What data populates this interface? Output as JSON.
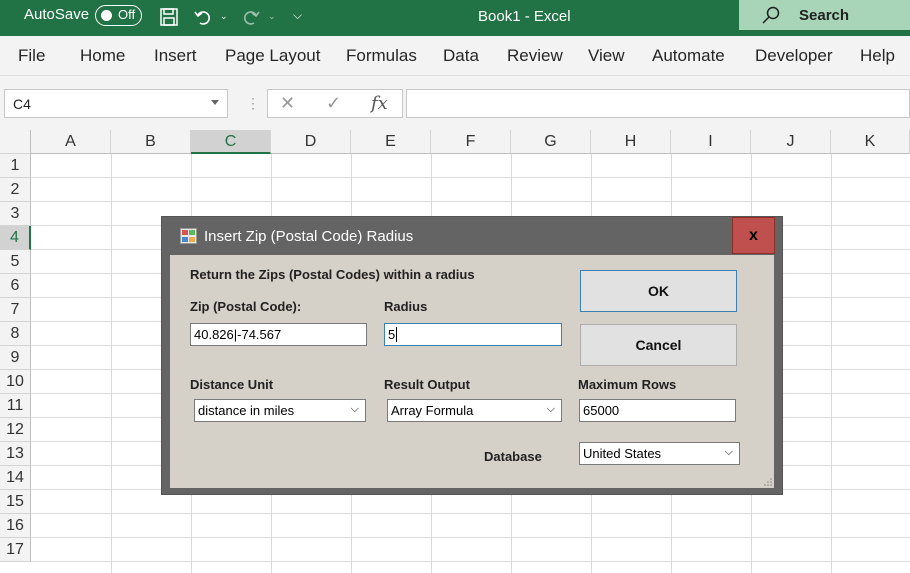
{
  "titlebar": {
    "autosave_label": "AutoSave",
    "autosave_state": "Off",
    "document_title": "Book1  -  Excel",
    "search_label": "Search",
    "icons": [
      "save-icon",
      "undo-icon",
      "redo-icon",
      "customize-qat-icon",
      "search-icon"
    ]
  },
  "ribbon": {
    "tabs": [
      "File",
      "Home",
      "Insert",
      "Page Layout",
      "Formulas",
      "Data",
      "Review",
      "View",
      "Automate",
      "Developer",
      "Help"
    ]
  },
  "formula_bar": {
    "name_box": "C4",
    "fx_label": "fx",
    "formula": ""
  },
  "sheet": {
    "columns": [
      "A",
      "B",
      "C",
      "D",
      "E",
      "F",
      "G",
      "H",
      "I",
      "J",
      "K"
    ],
    "rows": [
      "1",
      "2",
      "3",
      "4",
      "5",
      "6",
      "7",
      "8",
      "9",
      "10",
      "11",
      "12",
      "13",
      "14",
      "15",
      "16",
      "17"
    ],
    "selected_column": "C",
    "selected_row": "4"
  },
  "dialog": {
    "title": "Insert Zip (Postal Code) Radius",
    "close_label": "x",
    "instruction": "Return the Zips (Postal Codes) within a radius",
    "zip_label": "Zip (Postal Code):",
    "zip_value": "40.826|-74.567",
    "radius_label": "Radius",
    "radius_value": "5",
    "distance_unit_label": "Distance Unit",
    "distance_unit_value": "distance in miles",
    "result_output_label": "Result Output",
    "result_output_value": "Array Formula",
    "max_rows_label": "Maximum Rows",
    "max_rows_value": "65000",
    "database_label": "Database",
    "database_value": "United States",
    "ok_label": "OK",
    "cancel_label": "Cancel"
  },
  "colors": {
    "excel_green": "#217346",
    "dialog_frame": "#646464",
    "dialog_body": "#d5d0c8",
    "close_button": "#c0504d"
  }
}
